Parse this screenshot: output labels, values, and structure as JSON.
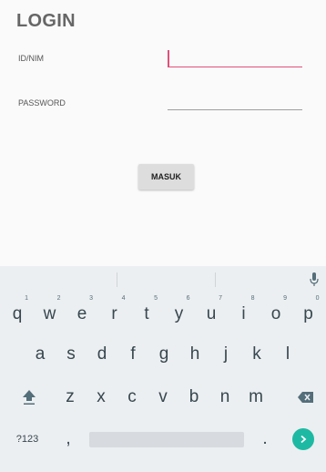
{
  "login": {
    "title": "LOGIN",
    "id_label": "ID/NIM",
    "id_value": "",
    "password_label": "PASSWORD",
    "password_value": "",
    "submit_label": "MASUK"
  },
  "colors": {
    "accent_pink": "#e0507a",
    "enter_teal": "#1eb9a3",
    "keyboard_bg": "#eceff1"
  },
  "keyboard": {
    "row1": [
      {
        "char": "q",
        "hint": "1"
      },
      {
        "char": "w",
        "hint": "2"
      },
      {
        "char": "e",
        "hint": "3"
      },
      {
        "char": "r",
        "hint": "4"
      },
      {
        "char": "t",
        "hint": "5"
      },
      {
        "char": "y",
        "hint": "6"
      },
      {
        "char": "u",
        "hint": "7"
      },
      {
        "char": "i",
        "hint": "8"
      },
      {
        "char": "o",
        "hint": "9"
      },
      {
        "char": "p",
        "hint": "0"
      }
    ],
    "row2": [
      "a",
      "s",
      "d",
      "f",
      "g",
      "h",
      "j",
      "k",
      "l"
    ],
    "row3": [
      "z",
      "x",
      "c",
      "v",
      "b",
      "n",
      "m"
    ],
    "symbols_label": "?123",
    "comma": ",",
    "period": ".",
    "icons": {
      "mic": "mic-icon",
      "shift": "shift-icon",
      "backspace": "backspace-icon",
      "enter": "enter-arrow-icon"
    }
  }
}
